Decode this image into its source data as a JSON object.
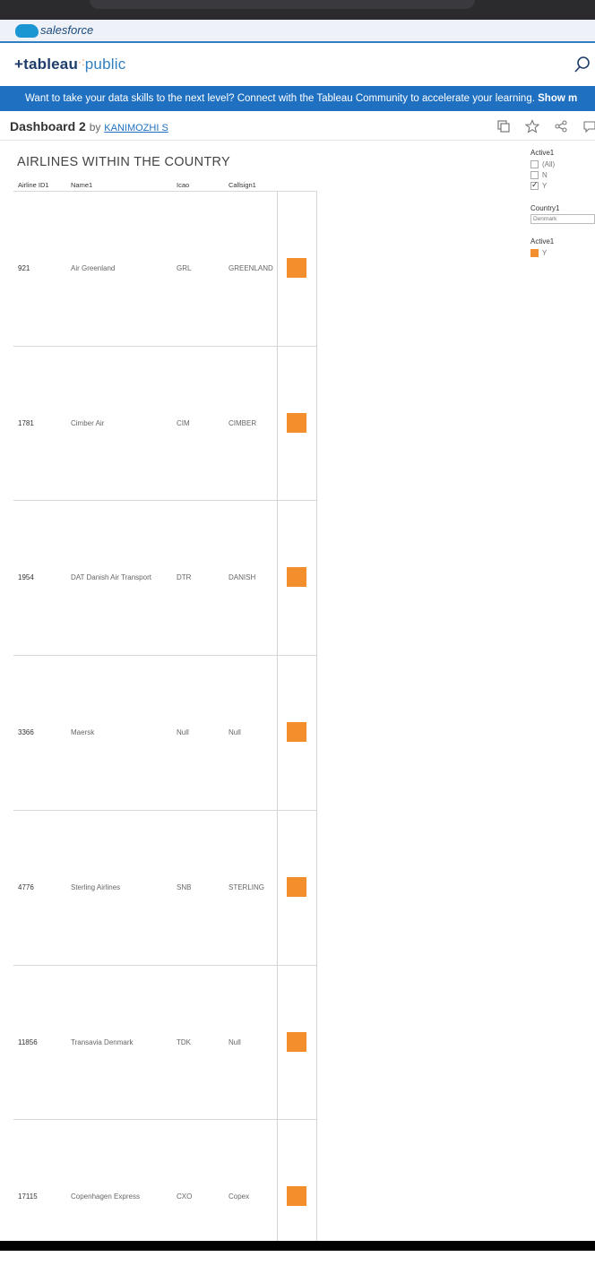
{
  "salesforce": {
    "label": "salesforce"
  },
  "tableau": {
    "logo_left": "+tableau",
    "logo_dots": "·:",
    "logo_right": "public"
  },
  "banner": {
    "message": "Want to take your data skills to the next level? Connect with the Tableau Community to accelerate your learning.",
    "cta": "Show m"
  },
  "dashboard": {
    "title": "Dashboard 2",
    "by": "by",
    "author": "KANIMOZHI S"
  },
  "viz": {
    "title": "AIRLINES WITHIN THE COUNTRY",
    "columns": [
      "Airline ID1",
      "Name1",
      "Icao",
      "Callsign1"
    ],
    "rows": [
      {
        "id": "921",
        "name": "Air Greenland",
        "icao": "GRL",
        "callsign": "GREENLAND"
      },
      {
        "id": "1781",
        "name": "Cimber Air",
        "icao": "CIM",
        "callsign": "CIMBER"
      },
      {
        "id": "1954",
        "name": "DAT Danish Air Transport",
        "icao": "DTR",
        "callsign": "DANISH"
      },
      {
        "id": "3366",
        "name": "Maersk",
        "icao": "Null",
        "callsign": "Null"
      },
      {
        "id": "4776",
        "name": "Sterling Airlines",
        "icao": "SNB",
        "callsign": "STERLING"
      },
      {
        "id": "11856",
        "name": "Transavia Denmark",
        "icao": "TDK",
        "callsign": "Null"
      },
      {
        "id": "17115",
        "name": "Copenhagen Express",
        "icao": "CXO",
        "callsign": "Copex"
      }
    ],
    "mark_color": "#f28e2b"
  },
  "filters": {
    "active_filter": {
      "title": "Active1",
      "options": [
        {
          "label": "(All)",
          "checked": false
        },
        {
          "label": "N",
          "checked": false
        },
        {
          "label": "Y",
          "checked": true
        }
      ]
    },
    "country_filter": {
      "title": "Country1",
      "value": "Denmark"
    },
    "active_legend": {
      "title": "Active1",
      "item": "Y"
    }
  },
  "colors": {
    "brand_blue": "#1f70c1",
    "orange": "#f28e2b"
  }
}
